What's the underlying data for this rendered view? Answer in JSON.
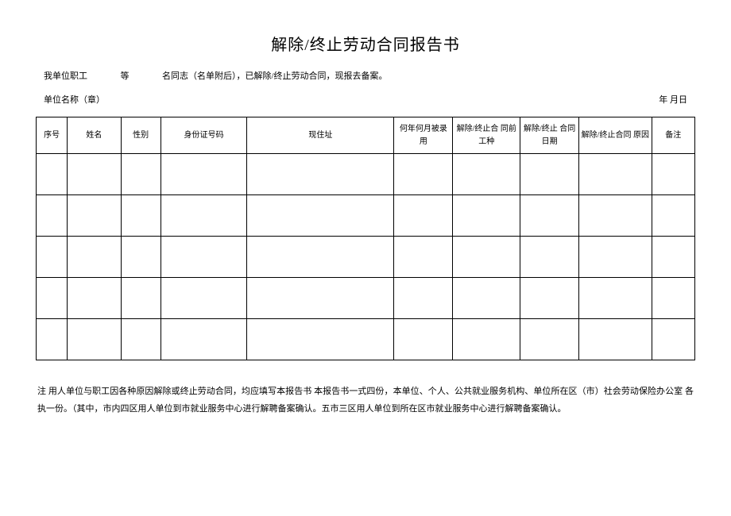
{
  "title": "解除/终止劳动合同报告书",
  "intro": {
    "prefix": "我单位职工",
    "gap1": "　　　",
    "etc": "等",
    "gap2": "　　　",
    "suffix": "名同志（名单附后），已解除/终止劳动合同，现报去备案。"
  },
  "meta": {
    "left": "单位名称（章）",
    "right": "年 月日"
  },
  "headers": {
    "seq": "序号",
    "name": "姓名",
    "gender": "性别",
    "id": "身份证号码",
    "addr": "现住址",
    "hired": "何年何月被录用",
    "pre": "解除/终止合 同前工种",
    "date": "解除/终止 合同日期",
    "reason": "解除/终止合同 原因",
    "note": "备注"
  },
  "rows": [
    {
      "seq": "",
      "name": "",
      "gender": "",
      "id": "",
      "addr": "",
      "hired": "",
      "pre": "",
      "date": "",
      "reason": "",
      "note": ""
    },
    {
      "seq": "",
      "name": "",
      "gender": "",
      "id": "",
      "addr": "",
      "hired": "",
      "pre": "",
      "date": "",
      "reason": "",
      "note": ""
    },
    {
      "seq": "",
      "name": "",
      "gender": "",
      "id": "",
      "addr": "",
      "hired": "",
      "pre": "",
      "date": "",
      "reason": "",
      "note": ""
    },
    {
      "seq": "",
      "name": "",
      "gender": "",
      "id": "",
      "addr": "",
      "hired": "",
      "pre": "",
      "date": "",
      "reason": "",
      "note": ""
    },
    {
      "seq": "",
      "name": "",
      "gender": "",
      "id": "",
      "addr": "",
      "hired": "",
      "pre": "",
      "date": "",
      "reason": "",
      "note": ""
    }
  ],
  "footnote": "注 用人单位与职工因各种原因解除或终止劳动合同，均应填写本报告书 本报告书一式四份，本单位、个人、公共就业服务机构、单位所在区（市）社会劳动保险办公室 各执一份。（其中，市内四区用人单位到市就业服务中心进行解聘备案确认。五市三区用人单位到所在区市就业服务中心进行解聘备案确认。"
}
